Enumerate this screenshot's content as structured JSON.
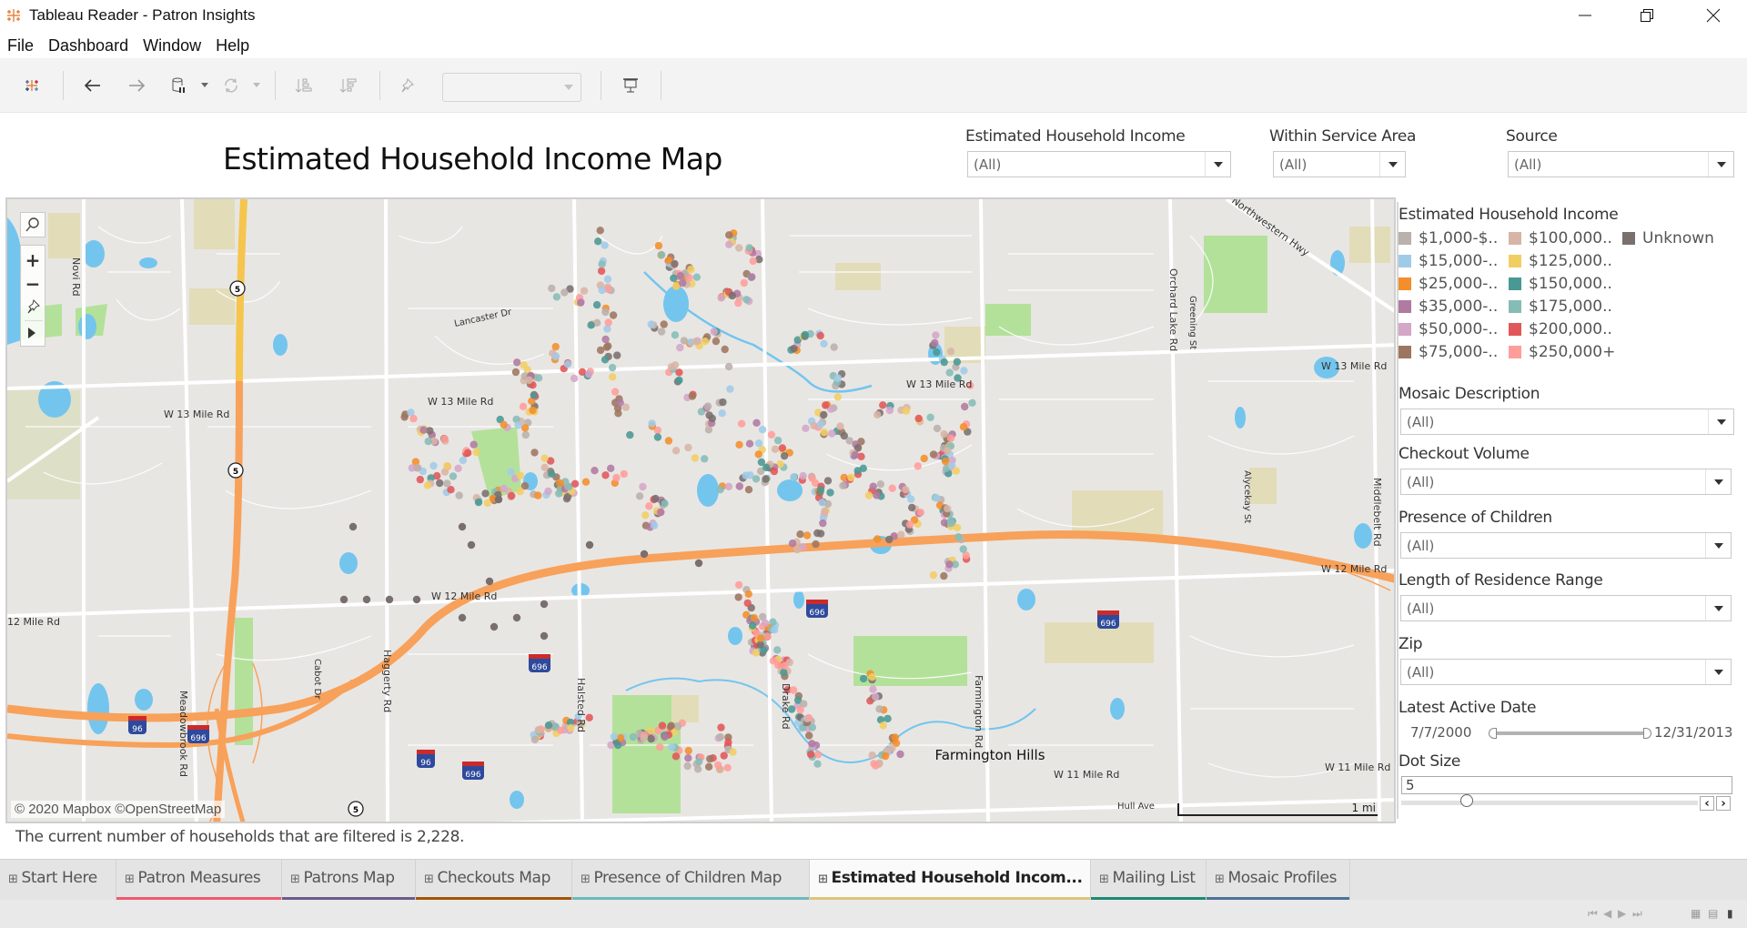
{
  "window": {
    "title": "Tableau Reader - Patron Insights",
    "controls": {
      "minimize": "minimize",
      "restore": "restore",
      "close": "close"
    }
  },
  "menu": [
    "File",
    "Dashboard",
    "Window",
    "Help"
  ],
  "toolbar": {
    "icons": [
      "tableau-logo",
      "back-arrow",
      "forward-arrow",
      "pause-data-updates",
      "refresh",
      "sort-ascending",
      "sort-descending",
      "pin",
      "presentation-mode"
    ],
    "dropdown_value": ""
  },
  "dashboard": {
    "title": "Estimated Household Income Map",
    "top_filters": [
      {
        "label": "Estimated Household Income",
        "value": "(All)"
      },
      {
        "label": "Within Service Area",
        "value": "(All)"
      },
      {
        "label": "Source",
        "value": "(All)"
      }
    ],
    "footer": "The current number of households that are filtered is 2,228."
  },
  "map": {
    "attribution": "© 2020 Mapbox ©OpenStreetMap",
    "scale_label": "1 mi",
    "controls": [
      "search",
      "zoom-in",
      "zoom-out",
      "pin",
      "expand"
    ],
    "road_labels": [
      "Novi Rd",
      "W 13 Mile Rd",
      "Lancaster Dr",
      "W 13 Mile Rd",
      "Meadowbrook Rd",
      "Cabot Dr",
      "Haggerty Rd",
      "Halsted Rd",
      "Drake Rd",
      "W 13 Mile Rd",
      "Farmington Rd",
      "Orchard Lake Rd",
      "Greening St",
      "Northwestern Hwy",
      "W 13 Mile Rd",
      "Alycekay St",
      "Middlebelt Rd",
      "W 12 Mile Rd",
      "W 12 Mile Rd",
      "12 Mile Rd",
      "W 11 Mile Rd",
      "W 11 Mile Rd",
      "Hull Ave"
    ],
    "place_label": "Farmington Hills",
    "shields": {
      "interstate_696": "696",
      "interstate_96": "96",
      "state_5": "5"
    }
  },
  "legend": {
    "title": "Estimated Household Income",
    "items": [
      {
        "label": "$1,000-$..",
        "color": "#bab0ac"
      },
      {
        "label": "$15,000-..",
        "color": "#a0cbe8"
      },
      {
        "label": "$25,000-..",
        "color": "#f28e2b"
      },
      {
        "label": "$35,000-..",
        "color": "#b07aa1"
      },
      {
        "label": "$50,000-..",
        "color": "#d4a6c8"
      },
      {
        "label": "$75,000-..",
        "color": "#9d7660"
      },
      {
        "label": "$100,000..",
        "color": "#d7b5a6"
      },
      {
        "label": "$125,000..",
        "color": "#f1ce63"
      },
      {
        "label": "$150,000..",
        "color": "#499894"
      },
      {
        "label": "$175,000..",
        "color": "#86bcb6"
      },
      {
        "label": "$200,000..",
        "color": "#e15759"
      },
      {
        "label": "$250,000+",
        "color": "#ff9d9a"
      },
      {
        "label": "Unknown",
        "color": "#79706e"
      }
    ]
  },
  "side_filters": [
    {
      "label": "Mosaic Description",
      "value": "(All)"
    },
    {
      "label": "Checkout Volume",
      "value": "(All)"
    },
    {
      "label": "Presence of Children",
      "value": "(All)"
    },
    {
      "label": "Length of Residence Range",
      "value": "(All)"
    },
    {
      "label": "Zip",
      "value": "(All)"
    }
  ],
  "latest_active_date": {
    "label": "Latest Active Date",
    "start": "7/7/2000",
    "end": "12/31/2013"
  },
  "dot_size": {
    "label": "Dot Size",
    "value": "5"
  },
  "tabs": [
    {
      "label": "Start Here",
      "color": "#e4e4e4",
      "active": false
    },
    {
      "label": "Patron Measures",
      "color": "#f05a6e",
      "active": false
    },
    {
      "label": "Patrons Map",
      "color": "#6b5b8a",
      "active": false
    },
    {
      "label": "Checkouts Map",
      "color": "#a35408",
      "active": false
    },
    {
      "label": "Presence of Children Map",
      "color": "#6cbab8",
      "active": false
    },
    {
      "label": "Estimated Household Incom...",
      "color": "#dfc47a",
      "active": true
    },
    {
      "label": "Mailing List",
      "color": "#1b8a74",
      "active": false
    },
    {
      "label": "Mosaic Profiles",
      "color": "#4e7199",
      "active": false
    }
  ]
}
